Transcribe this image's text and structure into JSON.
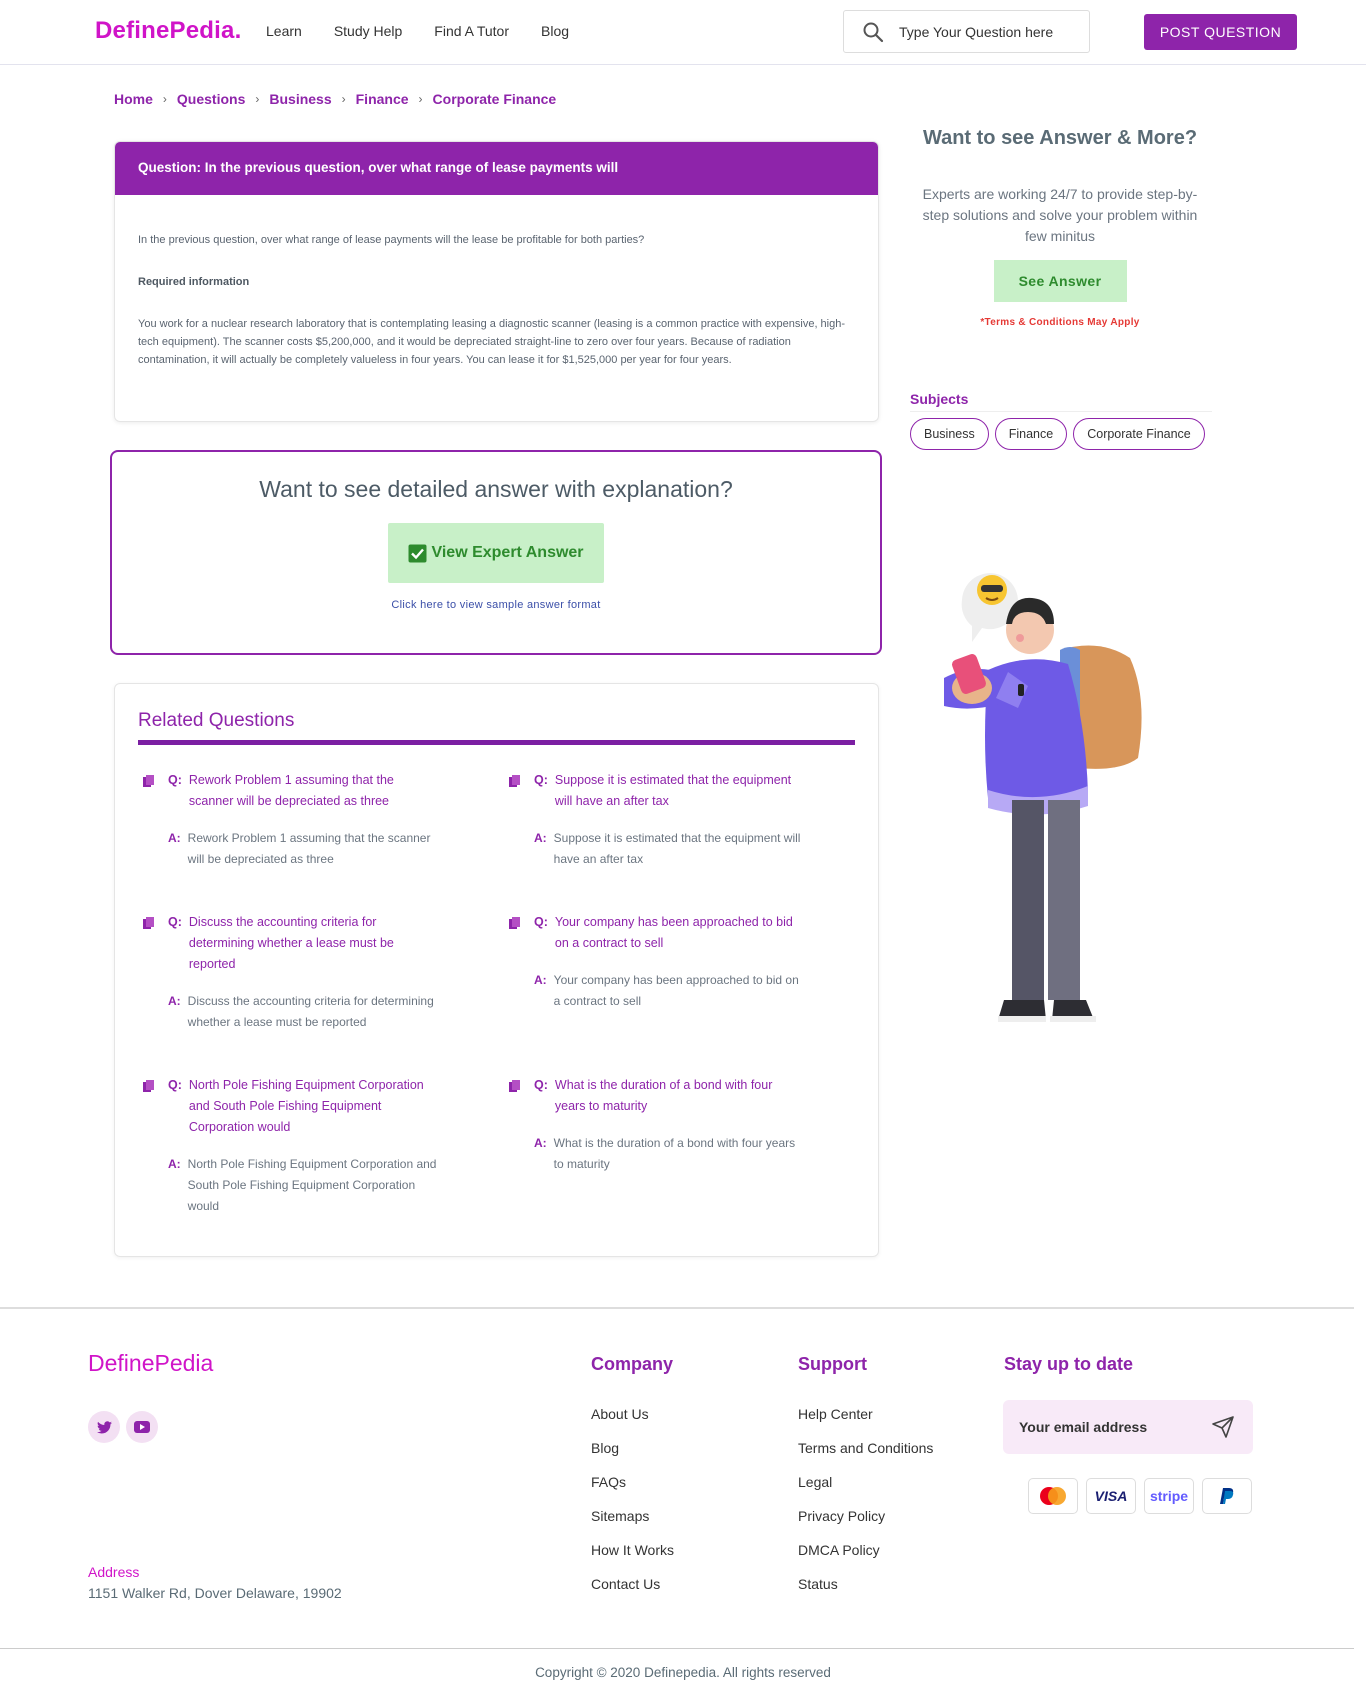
{
  "header": {
    "logo": "DefinePedia.",
    "nav": [
      "Learn",
      "Study Help",
      "Find A Tutor",
      "Blog"
    ],
    "search_placeholder": "Type Your Question here",
    "post_button": "POST QUESTION"
  },
  "breadcrumb": [
    "Home",
    "Questions",
    "Business",
    "Finance",
    "Corporate Finance"
  ],
  "question": {
    "header": "Question: In the previous question, over what range of lease payments will",
    "intro": "In the previous question, over what range of lease payments will the lease be profitable for both parties?",
    "required_label": "Required information",
    "body": "You work for a nuclear research laboratory that is contemplating leasing a diagnostic scanner (leasing is a common practice with expensive, high-tech equipment). The scanner costs $5,200,000, and it would be depreciated straight-line to zero over four years. Because of radiation contamination, it will actually be completely valueless in four years. You can lease it for $1,525,000 per year for four years."
  },
  "answer_box": {
    "title": "Want to see detailed answer with explanation?",
    "button": "View Expert Answer",
    "sample_link": "Click here to view sample answer format"
  },
  "related": {
    "title": "Related Questions",
    "q_tag": "Q:",
    "a_tag": "A:",
    "items": [
      {
        "q": "Rework Problem 1 assuming that the scanner will be depreciated as three",
        "a": "Rework Problem 1 assuming that the scanner will be depreciated as three"
      },
      {
        "q": "Suppose it is estimated that the equipment will have an after tax",
        "a": "Suppose it is estimated that the equipment will have an after tax"
      },
      {
        "q": "Discuss the accounting criteria for determining whether a lease must be reported",
        "a": "Discuss the accounting criteria for determining whether a lease must be reported"
      },
      {
        "q": "Your company has been approached to bid on a contract to sell",
        "a": "Your company has been approached to bid on a contract to sell"
      },
      {
        "q": "North Pole Fishing Equipment Corporation and South Pole Fishing Equipment Corporation would",
        "a": "North Pole Fishing Equipment Corporation and South Pole Fishing Equipment Corporation would"
      },
      {
        "q": "What is the duration of a bond with four years to maturity",
        "a": "What is the duration of a bond with four years to maturity"
      }
    ]
  },
  "sidebar": {
    "title": "Want to see Answer & More?",
    "description": "Experts are working 24/7 to provide step-by-step solutions and solve your problem within few minitus",
    "button": "See Answer",
    "terms": "*Terms & Conditions May Apply",
    "subjects_label": "Subjects",
    "subjects": [
      "Business",
      "Finance",
      "Corporate Finance"
    ]
  },
  "footer": {
    "logo": "DefinePedia",
    "address_label": "Address",
    "address": "1151 Walker Rd, Dover Delaware, 19902",
    "company": {
      "title": "Company",
      "links": [
        "About Us",
        "Blog",
        "FAQs",
        "Sitemaps",
        "How It Works",
        "Contact Us"
      ]
    },
    "support": {
      "title": "Support",
      "links": [
        "Help Center",
        "Terms and Conditions",
        "Legal",
        "Privacy Policy",
        "DMCA Policy",
        "Status"
      ]
    },
    "newsletter": {
      "title": "Stay up to date",
      "placeholder": "Your email address"
    },
    "payments": [
      "mastercard",
      "VISA",
      "stripe",
      "paypal"
    ],
    "copyright": "Copyright © 2020 Definepedia. All rights reserved"
  },
  "colors": {
    "brand": "#8e24aa",
    "logo": "#d014c8",
    "cta_bg": "#c8f0c8",
    "cta_text": "#2e8b2e",
    "warning": "#e53935"
  }
}
